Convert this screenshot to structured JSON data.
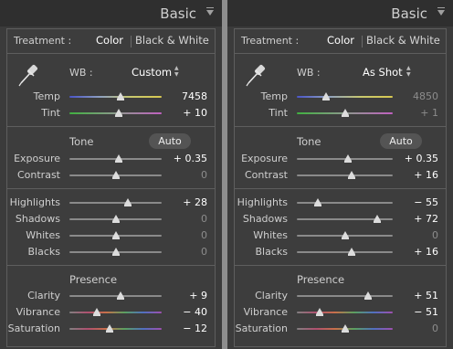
{
  "panels": [
    {
      "header": {
        "title": "Basic"
      },
      "treatment": {
        "label": "Treatment :",
        "color": "Color",
        "bw": "Black & White"
      },
      "wb": {
        "label": "WB :",
        "value": "Custom",
        "arrows_icon": "up-down-arrows-icon"
      },
      "wb_sliders": [
        {
          "label": "Temp",
          "value": "7458",
          "active": true,
          "pos": 0.55,
          "track": "temp"
        },
        {
          "label": "Tint",
          "value": "+ 10",
          "active": true,
          "pos": 0.53,
          "track": "tint"
        }
      ],
      "tone": {
        "title": "Tone",
        "auto": "Auto"
      },
      "tone_sliders": [
        {
          "label": "Exposure",
          "value": "+ 0.35",
          "active": true,
          "pos": 0.53,
          "track": "gray"
        },
        {
          "label": "Contrast",
          "value": "0",
          "active": false,
          "pos": 0.5,
          "track": "gray"
        }
      ],
      "light_sliders": [
        {
          "label": "Highlights",
          "value": "+ 28",
          "active": true,
          "pos": 0.63,
          "track": "gray"
        },
        {
          "label": "Shadows",
          "value": "0",
          "active": false,
          "pos": 0.5,
          "track": "gray"
        },
        {
          "label": "Whites",
          "value": "0",
          "active": false,
          "pos": 0.5,
          "track": "gray"
        },
        {
          "label": "Blacks",
          "value": "0",
          "active": false,
          "pos": 0.5,
          "track": "gray"
        }
      ],
      "presence": {
        "title": "Presence"
      },
      "presence_sliders": [
        {
          "label": "Clarity",
          "value": "+ 9",
          "active": true,
          "pos": 0.55,
          "track": "gray"
        },
        {
          "label": "Vibrance",
          "value": "− 40",
          "active": true,
          "pos": 0.3,
          "track": "vib"
        },
        {
          "label": "Saturation",
          "value": "− 12",
          "active": true,
          "pos": 0.44,
          "track": "vib"
        }
      ]
    },
    {
      "header": {
        "title": "Basic"
      },
      "treatment": {
        "label": "Treatment :",
        "color": "Color",
        "bw": "Black & White"
      },
      "wb": {
        "label": "WB :",
        "value": "As Shot",
        "arrows_icon": "up-down-arrows-icon"
      },
      "wb_sliders": [
        {
          "label": "Temp",
          "value": "4850",
          "active": false,
          "pos": 0.3,
          "track": "temp"
        },
        {
          "label": "Tint",
          "value": "+ 1",
          "active": false,
          "pos": 0.5,
          "track": "tint"
        }
      ],
      "tone": {
        "title": "Tone",
        "auto": "Auto"
      },
      "tone_sliders": [
        {
          "label": "Exposure",
          "value": "+ 0.35",
          "active": true,
          "pos": 0.53,
          "track": "gray"
        },
        {
          "label": "Contrast",
          "value": "+ 16",
          "active": true,
          "pos": 0.57,
          "track": "gray"
        }
      ],
      "light_sliders": [
        {
          "label": "Highlights",
          "value": "− 55",
          "active": true,
          "pos": 0.22,
          "track": "gray"
        },
        {
          "label": "Shadows",
          "value": "+ 72",
          "active": true,
          "pos": 0.84,
          "track": "gray"
        },
        {
          "label": "Whites",
          "value": "0",
          "active": false,
          "pos": 0.5,
          "track": "gray"
        },
        {
          "label": "Blacks",
          "value": "+ 16",
          "active": true,
          "pos": 0.57,
          "track": "gray"
        }
      ],
      "presence": {
        "title": "Presence"
      },
      "presence_sliders": [
        {
          "label": "Clarity",
          "value": "+ 51",
          "active": true,
          "pos": 0.74,
          "track": "gray"
        },
        {
          "label": "Vibrance",
          "value": "− 51",
          "active": true,
          "pos": 0.24,
          "track": "vib"
        },
        {
          "label": "Saturation",
          "value": "0",
          "active": false,
          "pos": 0.5,
          "track": "vib"
        }
      ]
    }
  ],
  "colors": {
    "panel_bg": "#3b3b3b",
    "header_bg": "#2f2f2f",
    "divider": "#8e8e8e",
    "active_value": "#ffffff",
    "inactive_value": "#8c8c8c"
  }
}
